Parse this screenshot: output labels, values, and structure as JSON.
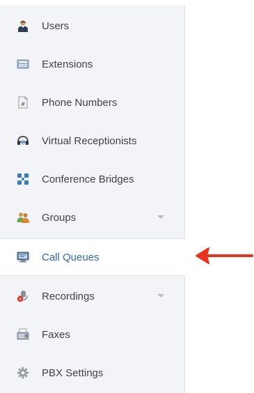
{
  "sidebar": {
    "items": [
      {
        "label": "Users",
        "icon": "user-icon"
      },
      {
        "label": "Extensions",
        "icon": "extensions-icon"
      },
      {
        "label": "Phone Numbers",
        "icon": "phone-number-icon"
      },
      {
        "label": "Virtual Receptionists",
        "icon": "receptionist-icon"
      },
      {
        "label": "Conference Bridges",
        "icon": "conference-bridge-icon"
      },
      {
        "label": "Groups",
        "icon": "groups-icon",
        "has_dropdown": true
      },
      {
        "label": "Call Queues",
        "icon": "call-queue-icon",
        "active": true
      },
      {
        "label": "Recordings",
        "icon": "recordings-icon",
        "has_dropdown": true
      },
      {
        "label": "Faxes",
        "icon": "fax-icon"
      },
      {
        "label": "PBX Settings",
        "icon": "gear-icon"
      }
    ]
  },
  "colors": {
    "sidebar_bg": "#f3f4f7",
    "active_text": "#2f68b5",
    "text": "#3f4247",
    "annotation_arrow": "#e8341c"
  },
  "annotation": {
    "icon": "red-arrow-left"
  }
}
